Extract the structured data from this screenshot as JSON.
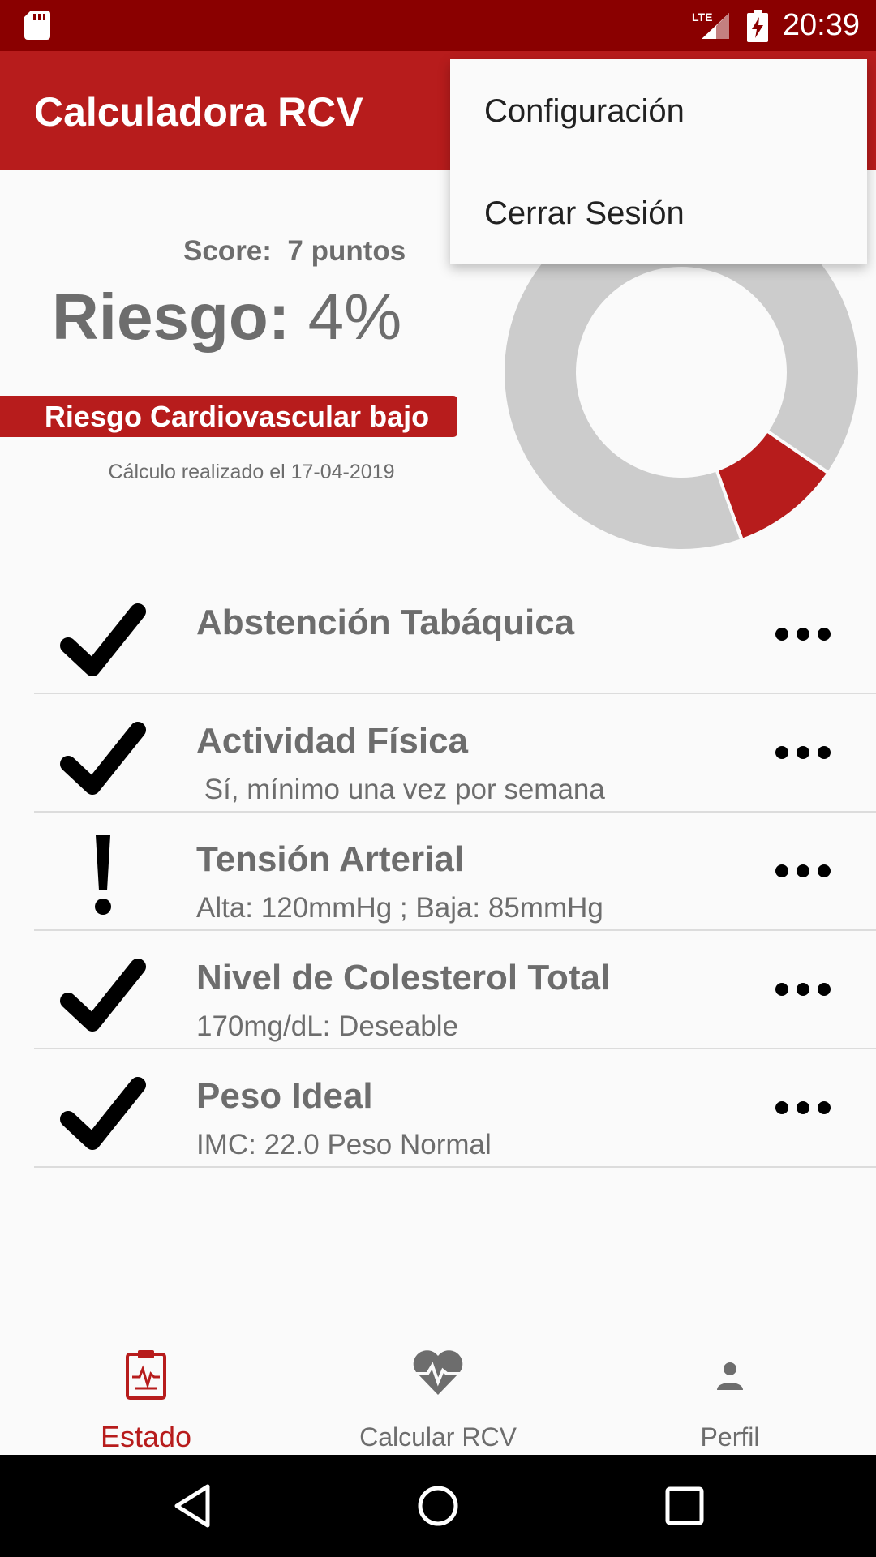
{
  "status_bar": {
    "time": "20:39",
    "network_label": "LTE"
  },
  "app_bar": {
    "title": "Calculadora RCV"
  },
  "overflow_menu": {
    "items": [
      "Configuración",
      "Cerrar Sesión"
    ]
  },
  "summary": {
    "score_label": "Score:",
    "score_value": "7 puntos",
    "risk_label": "Riesgo:",
    "risk_value": "4%",
    "risk_category": "Riesgo Cardiovascular bajo",
    "calc_date": "Cálculo realizado el 17-04-2019"
  },
  "donut": {
    "risk_fraction": 0.04,
    "accent": "#b71c1c",
    "rest_color": "#cccccc"
  },
  "factors": [
    {
      "icon": "check-icon",
      "title": "Abstención Tabáquica",
      "subtitle": ""
    },
    {
      "icon": "check-icon",
      "title": "Actividad Física",
      "subtitle": " Sí, mínimo una vez por semana"
    },
    {
      "icon": "exclamation-icon",
      "title": "Tensión Arterial",
      "subtitle": "Alta: 120mmHg ; Baja: 85mmHg"
    },
    {
      "icon": "check-icon",
      "title": "Nivel de Colesterol Total",
      "subtitle": "170mg/dL: Deseable"
    },
    {
      "icon": "check-icon",
      "title": "Peso Ideal",
      "subtitle": "IMC: 22.0 Peso Normal"
    }
  ],
  "bottom_nav": {
    "items": [
      {
        "label": "Estado",
        "icon": "clipboard-pulse-icon",
        "active": true
      },
      {
        "label": "Calcular RCV",
        "icon": "heart-pulse-icon",
        "active": false
      },
      {
        "label": "Perfil",
        "icon": "person-icon",
        "active": false
      }
    ]
  },
  "colors": {
    "primary": "#b71c1c",
    "primary_dark": "#8a0000",
    "text_gray": "#6d6d6d"
  }
}
